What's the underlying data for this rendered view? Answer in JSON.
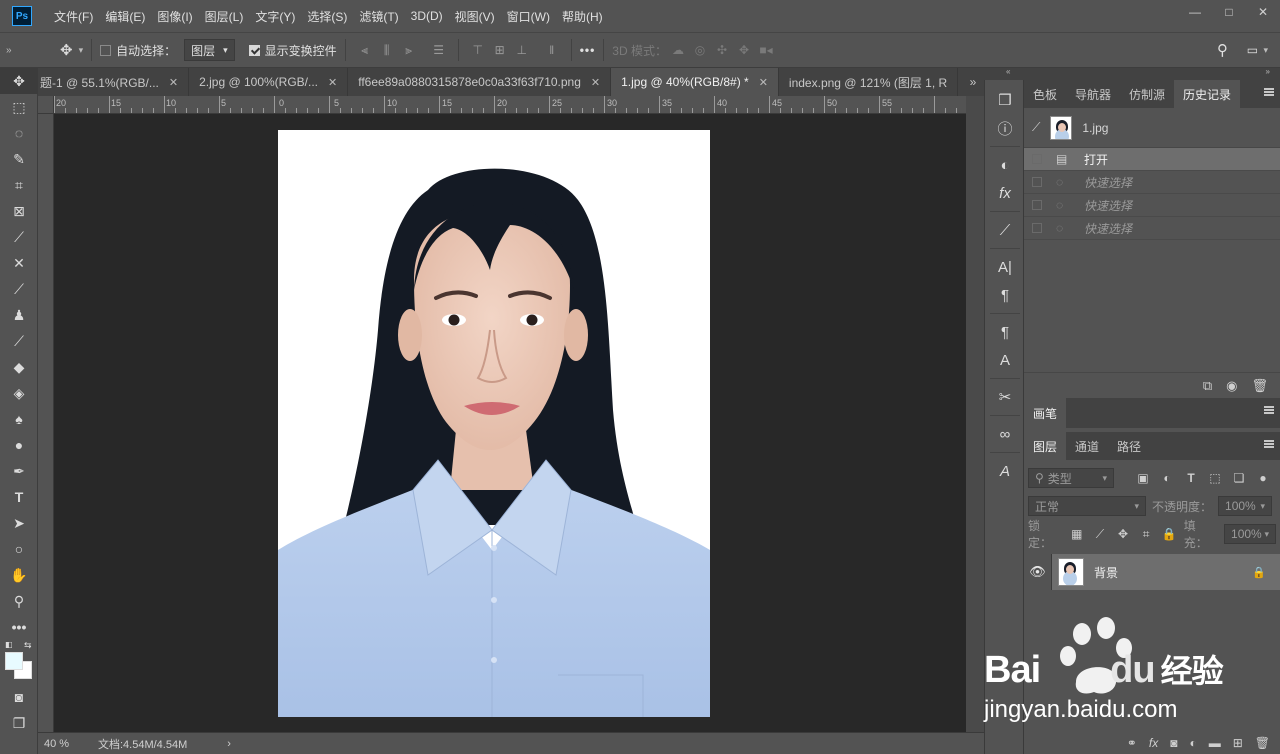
{
  "app": {
    "logo": "Ps"
  },
  "menu": [
    "文件(F)",
    "编辑(E)",
    "图像(I)",
    "图层(L)",
    "文字(Y)",
    "选择(S)",
    "滤镜(T)",
    "3D(D)",
    "视图(V)",
    "窗口(W)",
    "帮助(H)"
  ],
  "window_controls": {
    "minimize": "—",
    "restore": "□",
    "close": "✕"
  },
  "options": {
    "auto_select_label": "自动选择：",
    "auto_select_checked": false,
    "layer_select_value": "图层",
    "show_transform_label": "显示变换控件",
    "show_transform_checked": true,
    "more": "•••",
    "mode3d_label": "3D 模式："
  },
  "tabs": [
    {
      "label": "题-1 @ 55.1%(RGB/...",
      "close": "✕",
      "active": false
    },
    {
      "label": "2.jpg @ 100%(RGB/...",
      "close": "✕",
      "active": false
    },
    {
      "label": "ff6ee89a0880315878e0c0a33f63f710.png",
      "close": "✕",
      "active": false
    },
    {
      "label": "1.jpg @ 40%(RGB/8#) *",
      "close": "✕",
      "active": true
    },
    {
      "label": "index.png @ 121% (图层 1, R",
      "close": "",
      "active": false
    }
  ],
  "tab_overflow": "»",
  "ruler": {
    "labels": [
      "20",
      "15",
      "10",
      "5",
      "0",
      "5",
      "10",
      "15",
      "20",
      "25",
      "30",
      "35",
      "40",
      "45",
      "50",
      "55"
    ]
  },
  "colors": {
    "foreground": "#e8fbff",
    "background": "#ffffff",
    "accent": "#31a8ff"
  },
  "status": {
    "zoom": "40 %",
    "doc": "文档:4.54M/4.54M",
    "arrow": "›"
  },
  "history_panel": {
    "tabs": [
      {
        "label": "色板",
        "active": false
      },
      {
        "label": "导航器",
        "active": false
      },
      {
        "label": "仿制源",
        "active": false
      },
      {
        "label": "历史记录",
        "active": true
      }
    ],
    "snapshot": "1.jpg",
    "entries": [
      {
        "label": "打开",
        "state": "current"
      },
      {
        "label": "快速选择",
        "state": "undone"
      },
      {
        "label": "快速选择",
        "state": "undone"
      },
      {
        "label": "快速选择",
        "state": "undone"
      }
    ]
  },
  "brush_panel": {
    "tab": "画笔"
  },
  "layers_panel": {
    "tabs": [
      {
        "label": "图层",
        "active": true
      },
      {
        "label": "通道",
        "active": false
      },
      {
        "label": "路径",
        "active": false
      }
    ],
    "filter_placeholder": "类型",
    "blend_mode": "正常",
    "opacity_label": "不透明度：",
    "opacity_value": "100%",
    "lock_label": "锁定：",
    "fill_label": "填充：",
    "fill_value": "100%",
    "layers": [
      {
        "name": "背景",
        "locked": true,
        "visible": true
      }
    ]
  },
  "watermark": {
    "brand": "Bai",
    "brand_du": "du",
    "brand_suffix": "经验",
    "url": "jingyan.baidu.com"
  }
}
